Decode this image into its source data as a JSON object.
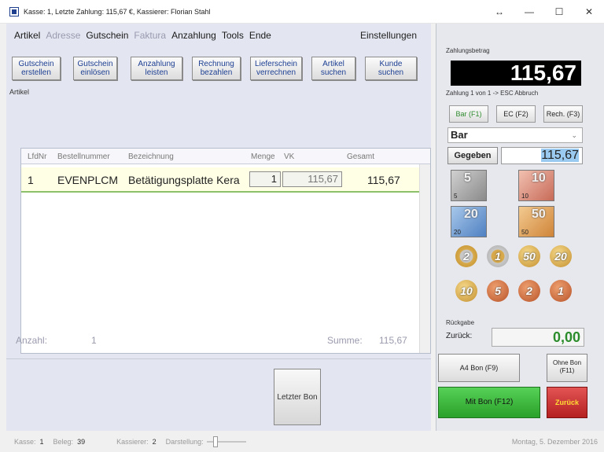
{
  "window": {
    "title": "Kasse: 1, Letzte Zahlung: 115,67 €, Kassierer: Florian Stahl",
    "controls": [
      "↔",
      "—",
      "☐",
      "✕"
    ]
  },
  "menu": {
    "items": [
      {
        "label": "Artikel",
        "enabled": true
      },
      {
        "label": "Adresse",
        "enabled": false
      },
      {
        "label": "Gutschein",
        "enabled": true
      },
      {
        "label": "Faktura",
        "enabled": false
      },
      {
        "label": "Anzahlung",
        "enabled": true
      },
      {
        "label": "Tools",
        "enabled": true
      },
      {
        "label": "Ende",
        "enabled": true
      }
    ],
    "settings": "Einstellungen"
  },
  "toolbar": {
    "buttons": [
      {
        "line1": "Gutschein",
        "line2": "erstellen"
      },
      {
        "line1": "Gutschein",
        "line2": "einlösen"
      },
      {
        "line1": "Anzahlung",
        "line2": "leisten"
      },
      {
        "line1": "Rechnung",
        "line2": "bezahlen"
      },
      {
        "line1": "Lieferschein",
        "line2": "verrechnen"
      },
      {
        "line1": "Artikel",
        "line2": "suchen"
      },
      {
        "line1": "Kunde",
        "line2": "suchen"
      }
    ]
  },
  "artikel_label": "Artikel",
  "grid": {
    "headers": [
      "LfdNr",
      "Bestellnummer",
      "Bezeichnung",
      "Menge",
      "VK",
      "Gesamt"
    ],
    "rows": [
      {
        "lfdnr": "1",
        "bestellnummer": "EVENPLCM",
        "bezeichnung": "Betätigungsplatte Kera",
        "menge": "1",
        "vk": "115,67",
        "gesamt": "115,67"
      }
    ]
  },
  "totals": {
    "anzahl_label": "Anzahl:",
    "anzahl_value": "1",
    "summe_label": "Summe:",
    "summe_value": "115,67"
  },
  "last_bon": "Letzter Bon",
  "status": {
    "kasse_label": "Kasse:",
    "kasse_value": "1",
    "beleg_label": "Beleg:",
    "beleg_value": "39",
    "kassierer_label": "Kassierer:",
    "kassierer_value": "2",
    "darstellung_label": "Darstellung:",
    "date": "Montag, 5. Dezember 2016"
  },
  "payment": {
    "zahlungsbetrag_label": "Zahlungsbetrag",
    "amount": "115,67",
    "info": "Zahlung 1 von 1 -> ESC Abbruch",
    "tabs": [
      "Bar (F1)",
      "EC (F2)",
      "Rech. (F3)"
    ],
    "method": "Bar",
    "gegeben_label": "Gegeben",
    "gegeben_value": "115,67",
    "notes": [
      {
        "value": "5",
        "color": "#b7b7b7"
      },
      {
        "value": "10",
        "color": "#d98b7b"
      },
      {
        "value": "20",
        "color": "#7aa6d6"
      },
      {
        "value": "50",
        "color": "#e0a25a"
      }
    ],
    "coins_row1": [
      {
        "value": "2",
        "style": "bi"
      },
      {
        "value": "1",
        "style": "bi2"
      },
      {
        "value": "50",
        "style": "gold"
      },
      {
        "value": "20",
        "style": "gold"
      }
    ],
    "coins_row2": [
      {
        "value": "10",
        "style": "gold"
      },
      {
        "value": "5",
        "style": "copper"
      },
      {
        "value": "2",
        "style": "copper"
      },
      {
        "value": "1",
        "style": "copper"
      }
    ],
    "rueckgabe_label": "Rückgabe",
    "zurueck_label": "Zurück:",
    "zurueck_value": "0,00",
    "a4_bon": "A4 Bon (F9)",
    "ohne_bon_line1": "Ohne Bon",
    "ohne_bon_line2": "(F11)",
    "mit_bon": "Mit Bon (F12)",
    "zurueck_btn": "Zurück"
  }
}
